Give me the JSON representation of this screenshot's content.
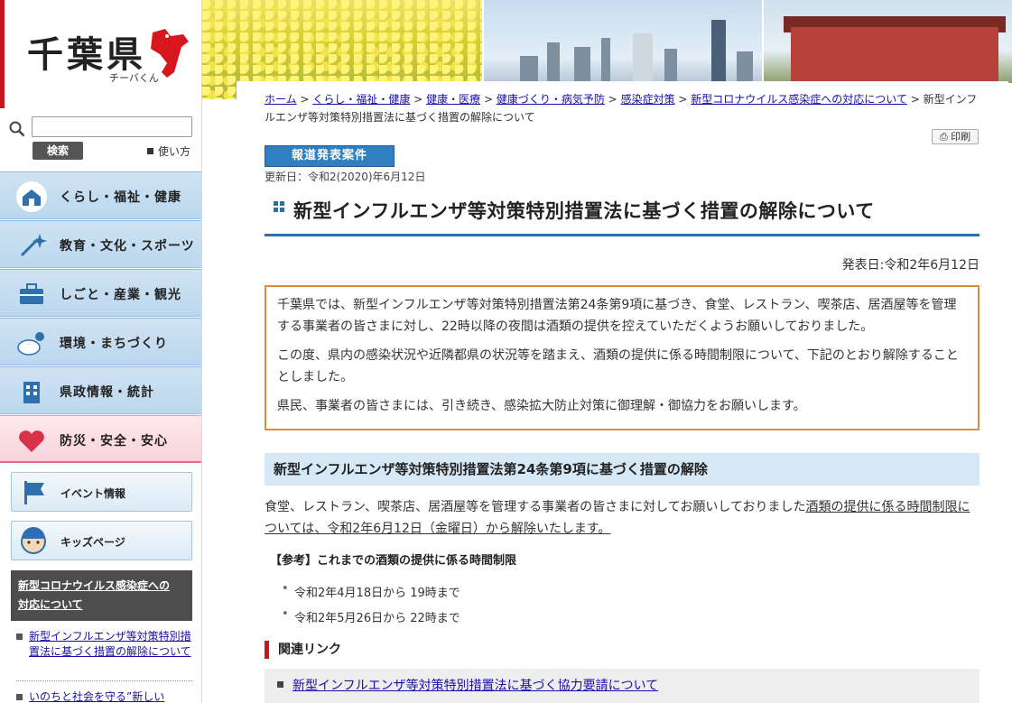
{
  "logo": {
    "prefecture": "千葉県",
    "mascot_name": "チーバくん"
  },
  "search": {
    "placeholder": "",
    "button": "検索",
    "howto": "使い方"
  },
  "categories": [
    {
      "label": "くらし・福祉・健康",
      "icon": "house-icon"
    },
    {
      "label": "教育・文化・スポーツ",
      "icon": "sparkle-icon"
    },
    {
      "label": "しごと・産業・観光",
      "icon": "briefcase-icon"
    },
    {
      "label": "環境・まちづくり",
      "icon": "cloud-sun-icon"
    },
    {
      "label": "県政情報・統計",
      "icon": "building-icon"
    },
    {
      "label": "防災・安全・安心",
      "icon": "heart-icon"
    }
  ],
  "subnav": [
    {
      "label": "イベント情報",
      "icon": "flag-icon"
    },
    {
      "label": "キッズページ",
      "icon": "kid-face-icon"
    }
  ],
  "covid_box": {
    "line1": "新型コロナウイルス感染症への",
    "line2": "対応について"
  },
  "side_links": [
    {
      "label": "新型インフルエンザ等対策特別措置法に基づく措置の解除について"
    },
    {
      "label": "いのちと社会を守る”新しい"
    }
  ],
  "breadcrumb": {
    "items": [
      "ホーム",
      "くらし・福祉・健康",
      "健康・医療",
      "健康づくり・病気予防",
      "感染症対策",
      "新型コロナウイルス感染症への対応について"
    ],
    "current": "新型インフルエンザ等対策特別措置法に基づく措置の解除について",
    "separator": ">"
  },
  "print_label": "印刷",
  "press_badge": "報道発表案件",
  "updated": "更新日：令和2(2020)年6月12日",
  "title": "新型インフルエンザ等対策特別措置法に基づく措置の解除について",
  "pub_date": "発表日:令和2年6月12日",
  "notice": {
    "p1": "千葉県では、新型インフルエンザ等対策特別措置法第24条第9項に基づき、食堂、レストラン、喫茶店、居酒屋等を管理する事業者の皆さまに対し、22時以降の夜間は酒類の提供を控えていただくようお願いしておりました。",
    "p2": "この度、県内の感染状況や近隣都県の状況等を踏まえ、酒類の提供に係る時間制限について、下記のとおり解除することとしました。",
    "p3": "県民、事業者の皆さまには、引き続き、感染拡大防止対策に御理解・御協力をお願いします。"
  },
  "section": {
    "heading": "新型インフルエンザ等対策特別措置法第24条第9項に基づく措置の解除",
    "body_plain": "食堂、レストラン、喫茶店、居酒屋等を管理する事業者の皆さまに対してお願いしておりました",
    "body_underlined": "酒類の提供に係る時間制限については、令和2年6月12日（金曜日）から解除いたします。",
    "ref_heading": "【参考】これまでの酒類の提供に係る時間制限",
    "ref_items": [
      "令和2年4月18日から 19時まで",
      "令和2年5月26日から 22時まで"
    ]
  },
  "related": {
    "heading": "関連リンク",
    "link": "新型インフルエンザ等対策特別措置法に基づく協力要請について"
  },
  "colors": {
    "accent_red": "#c8161d",
    "badge_blue": "#2f7fc1",
    "title_rule": "#2c6ea6",
    "notice_border": "#e08a3c",
    "section_bg": "#d6e8f6",
    "link": "#1a0dab"
  }
}
